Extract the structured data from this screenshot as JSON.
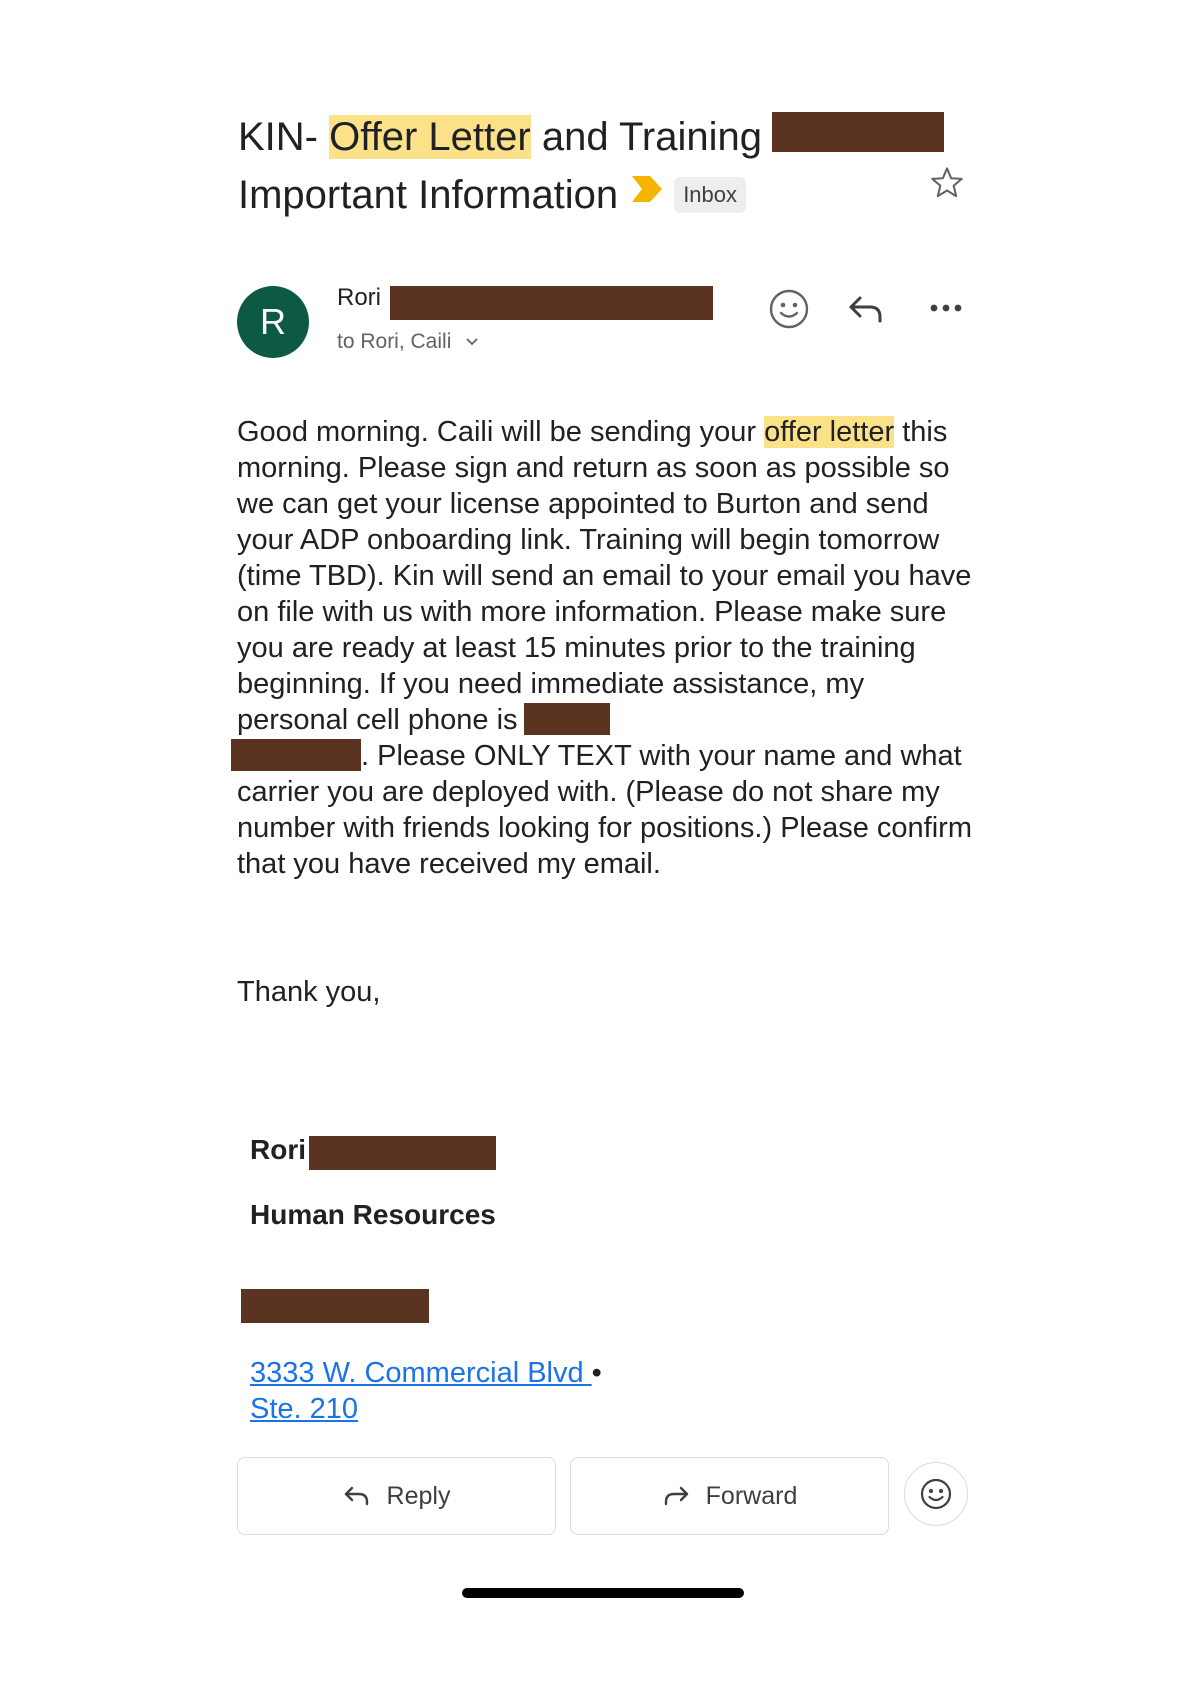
{
  "subject": {
    "prefix": "KIN- ",
    "highlight": "Offer Letter",
    "middle": " and Training",
    "line2": "Important Information",
    "label_chip": "Inbox"
  },
  "sender": {
    "avatar_letter": "R",
    "name": "Rori",
    "recipients": "to Rori, Caili"
  },
  "body": {
    "p1_a": "Good morning. Caili will be sending your ",
    "p1_highlight": "offer letter",
    "p1_b": " this morning. Please sign and return as soon as possible so we can get your license appointed to Burton and send your ADP onboarding link. Training will begin tomorrow (time TBD). Kin will send an email to your email you have on file with us with more information. Please make sure you are ready at least 15 minutes prior to the training beginning. If you need immediate assistance, my personal cell phone is",
    "p1_c": ". Please ONLY TEXT  with your name and what carrier you are deployed with. (Please do not share my number with friends looking for positions.) Please confirm that you have received my email.",
    "closing": "Thank you,"
  },
  "signature": {
    "name": "Rori",
    "department": "Human Resources",
    "address_line1": "3333 W. Commercial Blvd ",
    "address_sep": "•",
    "address_line2": "Ste. 210"
  },
  "actions": {
    "reply_label": "Reply",
    "forward_label": "Forward"
  },
  "icons": {
    "important_marker": "label-important-icon",
    "star": "star-outline-icon",
    "emoji": "emoji-reaction-icon",
    "reply": "reply-icon",
    "more": "more-options-icon",
    "forward": "forward-icon"
  },
  "colors": {
    "highlight": "#fbe289",
    "redaction": "#5a3321",
    "avatar_bg": "#0d5a44",
    "important_marker": "#f4b400",
    "link": "#1a73e8"
  }
}
